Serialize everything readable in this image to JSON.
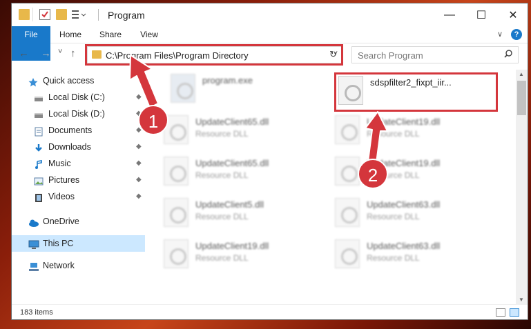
{
  "window": {
    "title": "Program",
    "minimize": "—",
    "maximize": "☐",
    "close": "✕"
  },
  "ribbon": {
    "tabs": [
      "File",
      "Home",
      "Share",
      "View"
    ],
    "expand": "∨",
    "help": "?"
  },
  "nav": {
    "back": "←",
    "forward": "→",
    "recent": "˅",
    "up": "↑",
    "refresh": "↻"
  },
  "address": {
    "path": "C:\\Program Files\\Program Directory",
    "dropdown": "˅"
  },
  "search": {
    "placeholder": "Search Program",
    "icon": "search-icon"
  },
  "sidebar": {
    "items": [
      {
        "label": "Quick access",
        "icon": "star-icon",
        "pinned": false
      },
      {
        "label": "Local Disk (C:)",
        "icon": "drive-icon",
        "pinned": true
      },
      {
        "label": "Local Disk (D:)",
        "icon": "drive-icon",
        "pinned": true
      },
      {
        "label": "Documents",
        "icon": "documents-icon",
        "pinned": true
      },
      {
        "label": "Downloads",
        "icon": "download-icon",
        "pinned": true
      },
      {
        "label": "Music",
        "icon": "music-icon",
        "pinned": true
      },
      {
        "label": "Pictures",
        "icon": "pictures-icon",
        "pinned": true
      },
      {
        "label": "Videos",
        "icon": "videos-icon",
        "pinned": true
      },
      {
        "label": "OneDrive",
        "icon": "cloud-icon",
        "pinned": false
      },
      {
        "label": "This PC",
        "icon": "computer-icon",
        "pinned": false,
        "selected": true
      },
      {
        "label": "Network",
        "icon": "network-icon",
        "pinned": false
      }
    ],
    "pin_glyph": "📌"
  },
  "files": [
    {
      "name": "program.exe",
      "type": ""
    },
    {
      "name": "sdspfilter2_fixpt_iir...",
      "type": ""
    },
    {
      "name": "UpdateClient65.dll",
      "type": "Resource DLL"
    },
    {
      "name": "UpdateClient19.dll",
      "type": "Resource DLL"
    },
    {
      "name": "UpdateClient65.dll",
      "type": "Resource DLL"
    },
    {
      "name": "UpdateClient19.dll",
      "type": "Resource DLL"
    },
    {
      "name": "UpdateClient5.dll",
      "type": "Resource DLL"
    },
    {
      "name": "UpdateClient63.dll",
      "type": "Resource DLL"
    },
    {
      "name": "UpdateClient19.dll",
      "type": "Resource DLL"
    },
    {
      "name": "UpdateClient63.dll",
      "type": "Resource DLL"
    }
  ],
  "status": {
    "items_count": "183 items"
  },
  "annotations": {
    "step1": "1",
    "step2": "2",
    "color": "#d4363c"
  }
}
